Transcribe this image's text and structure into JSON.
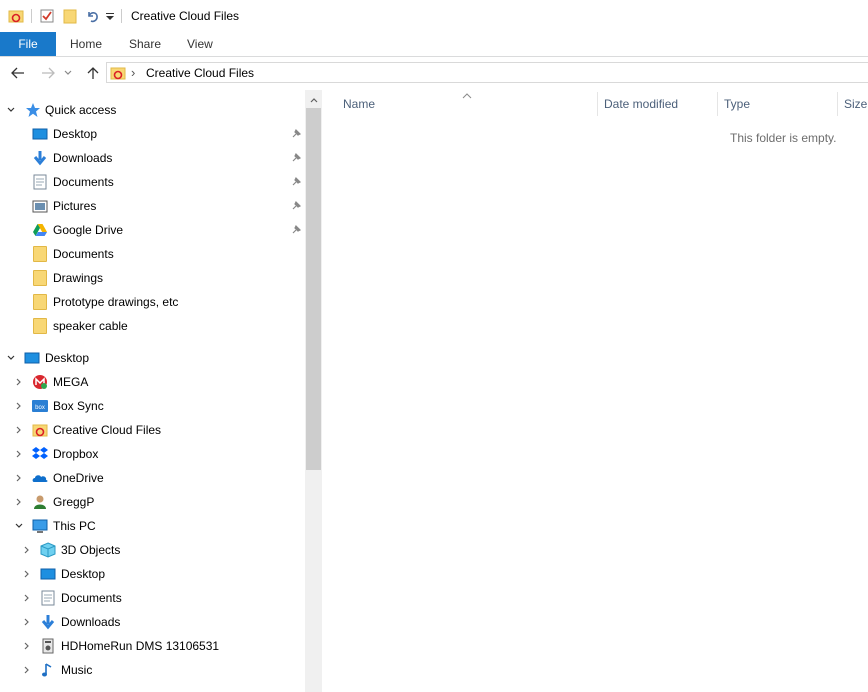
{
  "window": {
    "title": "Creative Cloud Files"
  },
  "ribbon": {
    "tabs": [
      "File",
      "Home",
      "Share",
      "View"
    ]
  },
  "address": {
    "separator": "›",
    "location": "Creative Cloud Files"
  },
  "columns": {
    "name": "Name",
    "date_modified": "Date modified",
    "type": "Type",
    "size": "Size"
  },
  "content": {
    "empty_message": "This folder is empty."
  },
  "sidebar": {
    "quick_access": {
      "label": "Quick access",
      "items": [
        {
          "label": "Desktop",
          "icon": "desktop-icon",
          "pinned": true
        },
        {
          "label": "Downloads",
          "icon": "download-arrow-icon",
          "pinned": true
        },
        {
          "label": "Documents",
          "icon": "documents-icon",
          "pinned": true
        },
        {
          "label": "Pictures",
          "icon": "pictures-icon",
          "pinned": true
        },
        {
          "label": "Google Drive",
          "icon": "google-drive-icon",
          "pinned": true
        },
        {
          "label": "Documents",
          "icon": "folder-icon",
          "pinned": false
        },
        {
          "label": "Drawings",
          "icon": "folder-icon",
          "pinned": false
        },
        {
          "label": "Prototype drawings, etc",
          "icon": "folder-icon",
          "pinned": false
        },
        {
          "label": "speaker cable",
          "icon": "folder-icon",
          "pinned": false
        }
      ]
    },
    "desktop": {
      "label": "Desktop",
      "items": [
        {
          "label": "MEGA",
          "icon": "mega-icon"
        },
        {
          "label": "Box Sync",
          "icon": "box-icon"
        },
        {
          "label": "Creative Cloud Files",
          "icon": "creative-cloud-icon"
        },
        {
          "label": "Dropbox",
          "icon": "dropbox-icon"
        },
        {
          "label": "OneDrive",
          "icon": "onedrive-icon"
        },
        {
          "label": "GreggP",
          "icon": "user-icon"
        },
        {
          "label": "This PC",
          "icon": "this-pc-icon"
        }
      ]
    },
    "this_pc": {
      "items": [
        {
          "label": "3D Objects",
          "icon": "3d-objects-icon"
        },
        {
          "label": "Desktop",
          "icon": "desktop-icon"
        },
        {
          "label": "Documents",
          "icon": "documents-icon"
        },
        {
          "label": "Downloads",
          "icon": "download-arrow-icon"
        },
        {
          "label": "HDHomeRun DMS 13106531",
          "icon": "media-server-icon"
        },
        {
          "label": "Music",
          "icon": "music-icon"
        }
      ]
    }
  },
  "colors": {
    "accent": "#1979ca",
    "header_text": "#4c607a",
    "folder": "#f8d775"
  }
}
